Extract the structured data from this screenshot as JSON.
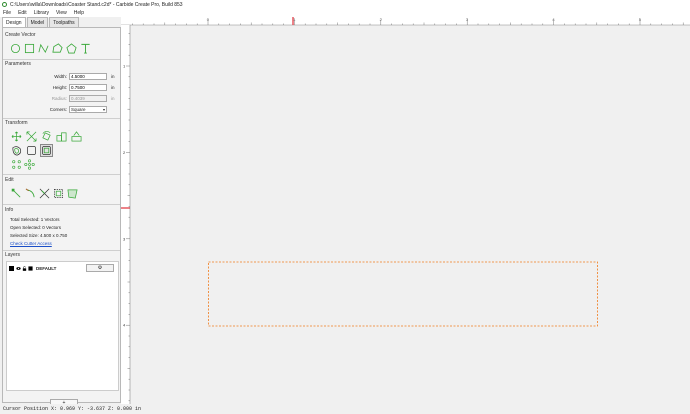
{
  "window": {
    "title": "C:\\Users\\willa\\Downloads\\Coaster Stand.c2d* - Carbide Create Pro, Build 853"
  },
  "menu": [
    "File",
    "Edit",
    "Library",
    "View",
    "Help"
  ],
  "tabs": {
    "design": "Design",
    "model": "Model",
    "toolpaths": "Toolpaths"
  },
  "sections": {
    "create_vector": "Create Vector",
    "parameters": "Parameters",
    "transform": "Transform",
    "edit": "Edit",
    "info": "Info",
    "layers": "Layers"
  },
  "create_vector_icons": [
    "circle-icon",
    "rectangle-icon",
    "polyline-icon",
    "polygon-icon",
    "pentagon-icon",
    "text-icon"
  ],
  "parameters": {
    "width_label": "Width:",
    "width_value": "4.5000",
    "width_unit": "in",
    "height_label": "Height:",
    "height_value": "0.7500",
    "height_unit": "in",
    "radius_label": "Radius:",
    "radius_value": "0.4039",
    "radius_unit": "in",
    "corners_label": "Corners:",
    "corners_value": "Square"
  },
  "transform_icons_row1": [
    "move-icon",
    "scale-icon",
    "rotate-icon",
    "align-icon",
    "mirror-icon"
  ],
  "transform_icons_row2": [
    "offset-icon",
    "rounded-square-icon",
    "fillet-icon"
  ],
  "transform_icons_row3": [
    "array-icon",
    "circular-array-icon"
  ],
  "edit_icons": [
    "node-edit-icon",
    "knife-icon",
    "trim-icon",
    "boolean-icon",
    "join-icon"
  ],
  "info": {
    "total_selected": "Total Selected:   1 Vectors",
    "open_selected": "Open Selected:   0 Vectors",
    "selected_size": "Selected Size:    4.500 x 0.750",
    "check_link": "Check Cutter Access"
  },
  "layers": {
    "name": "DEFAULT",
    "gear": "⚙",
    "add": "+"
  },
  "status": {
    "cursor": "Cursor Position X: 0.969 Y: -3.637 Z: 0.000 in"
  },
  "ruler": {
    "h_labels": [
      "0",
      "1",
      "2",
      "3",
      "4",
      "5"
    ],
    "v_labels": [
      "1",
      "2",
      "3",
      "4"
    ]
  },
  "colors": {
    "accent": "#3aa83a",
    "selection": "#f07a1a",
    "ruler_marker": "#e0303a"
  }
}
